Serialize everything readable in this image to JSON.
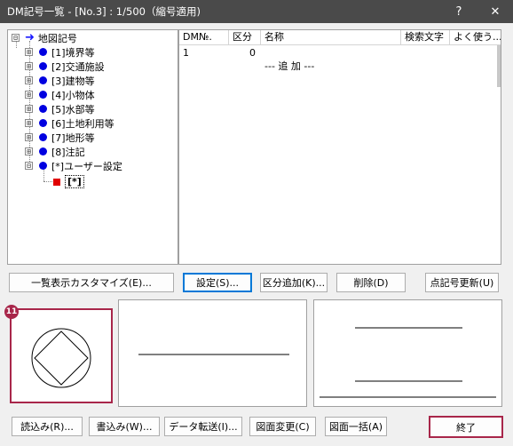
{
  "window": {
    "title": "DM記号一覧 - [No.3] : 1/500（縮号適用)",
    "help_label": "?",
    "close_label": "✕"
  },
  "tree": {
    "root_label": "地図記号",
    "items": [
      {
        "label": "[1]境界等",
        "expander": "⊞"
      },
      {
        "label": "[2]交通施設",
        "expander": "⊞"
      },
      {
        "label": "[3]建物等",
        "expander": "⊞"
      },
      {
        "label": "[4]小物体",
        "expander": "⊞"
      },
      {
        "label": "[5]水部等",
        "expander": "⊞"
      },
      {
        "label": "[6]土地利用等",
        "expander": "⊞"
      },
      {
        "label": "[7]地形等",
        "expander": "⊞"
      },
      {
        "label": "[8]注記",
        "expander": "⊞"
      },
      {
        "label": "[*]ユーザー設定",
        "expander": "⊟"
      }
    ],
    "child": {
      "label": "[*]"
    },
    "root_expander": "⊟"
  },
  "list": {
    "columns": [
      "DM№.",
      "区分",
      "名称",
      "検索文字",
      "よく使う..."
    ],
    "rows": [
      {
        "dm_no": "1",
        "kubun": "0",
        "name": ""
      }
    ],
    "add_row_label": "--- 追 加 ---"
  },
  "buttons_mid": {
    "customize": "一覧表示カスタマイズ(E)...",
    "settings": "設定(S)...",
    "add_category": "区分追加(K)...",
    "delete": "削除(D)",
    "update_point": "点記号更新(U)"
  },
  "buttons_bottom": {
    "load": "読込み(R)...",
    "write": "書込み(W)...",
    "data_transfer": "データ転送(I)...",
    "change_drawing": "図面変更(C)",
    "batch_drawing": "図面一括(A)",
    "exit": "終了"
  },
  "badge": {
    "number": "11"
  },
  "colors": {
    "title_bar": "#4a4a4a",
    "highlight": "#a8264a",
    "tree_dot": "#0000e0",
    "red_square": "#e00000"
  }
}
